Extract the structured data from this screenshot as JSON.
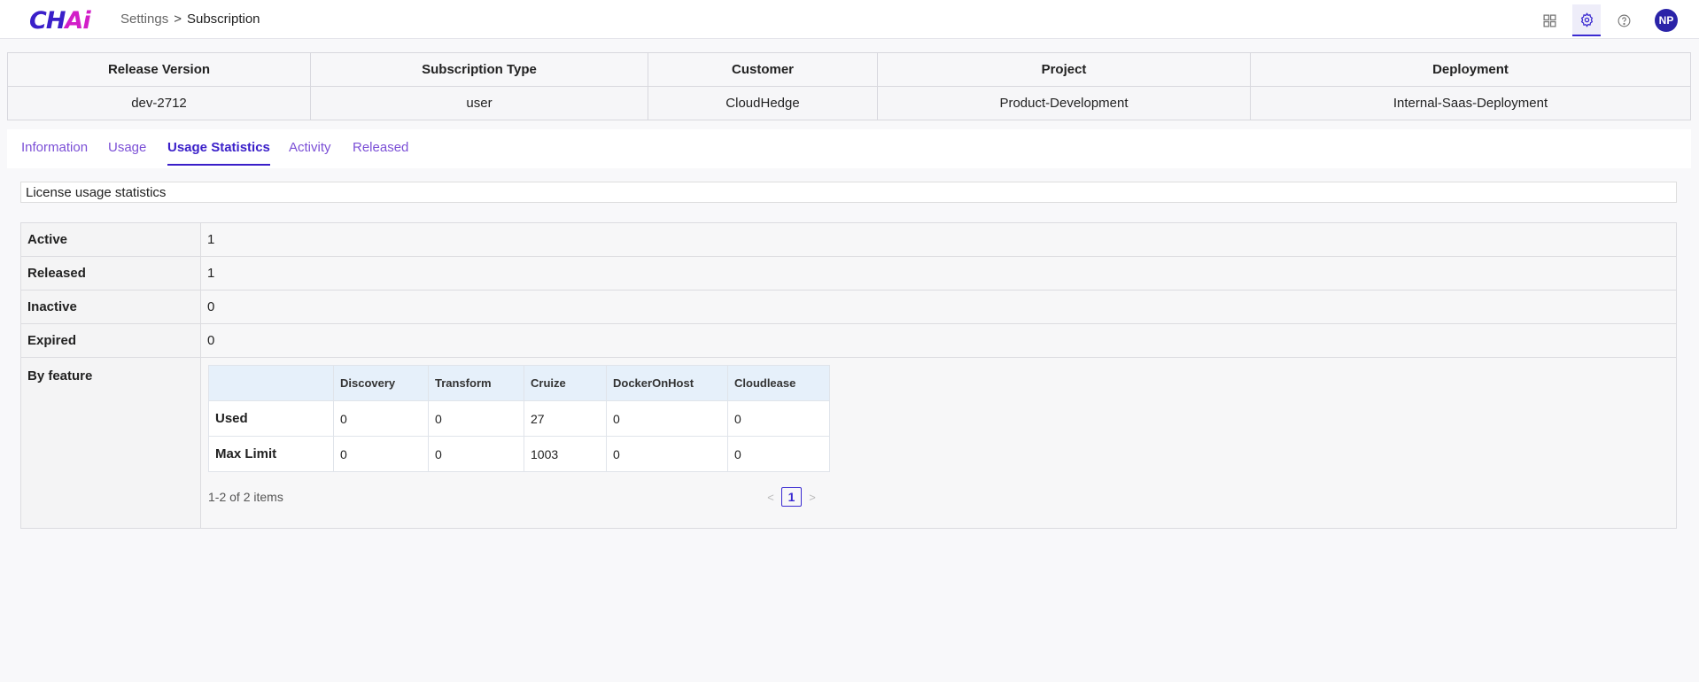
{
  "header": {
    "logo_main": "CH",
    "logo_accent": "Ai",
    "breadcrumb": [
      "Settings",
      ">",
      "Subscription"
    ],
    "icons": [
      "grid-icon",
      "gear-icon",
      "help-icon"
    ],
    "avatar": "NP",
    "accent_color": "#3a1fc9"
  },
  "summary": {
    "headers": [
      "Release Version",
      "Subscription Type",
      "Customer",
      "Project",
      "Deployment"
    ],
    "values": [
      "dev-2712",
      "user",
      "CloudHedge",
      "Product-Development",
      "Internal-Saas-Deployment"
    ]
  },
  "tabs": {
    "items": [
      "Information",
      "Usage",
      "Usage Statistics",
      "Activity",
      "Released"
    ],
    "active": "Usage Statistics"
  },
  "license": {
    "title": "License usage statistics",
    "stats": [
      {
        "label": "Active",
        "value": "1"
      },
      {
        "label": "Released",
        "value": "1"
      },
      {
        "label": "Inactive",
        "value": "0"
      },
      {
        "label": "Expired",
        "value": "0"
      }
    ],
    "by_feature_label": "By feature"
  },
  "features": {
    "columns": [
      "",
      "Discovery",
      "Transform",
      "Cruize",
      "DockerOnHost",
      "Cloudlease"
    ],
    "rows": [
      {
        "label": "Used",
        "values": [
          "0",
          "0",
          "27",
          "0",
          "0"
        ]
      },
      {
        "label": "Max Limit",
        "values": [
          "0",
          "0",
          "1003",
          "0",
          "0"
        ]
      }
    ],
    "pager_info": "1-2 of 2 items",
    "prev": "<",
    "page": "1",
    "next": ">"
  }
}
